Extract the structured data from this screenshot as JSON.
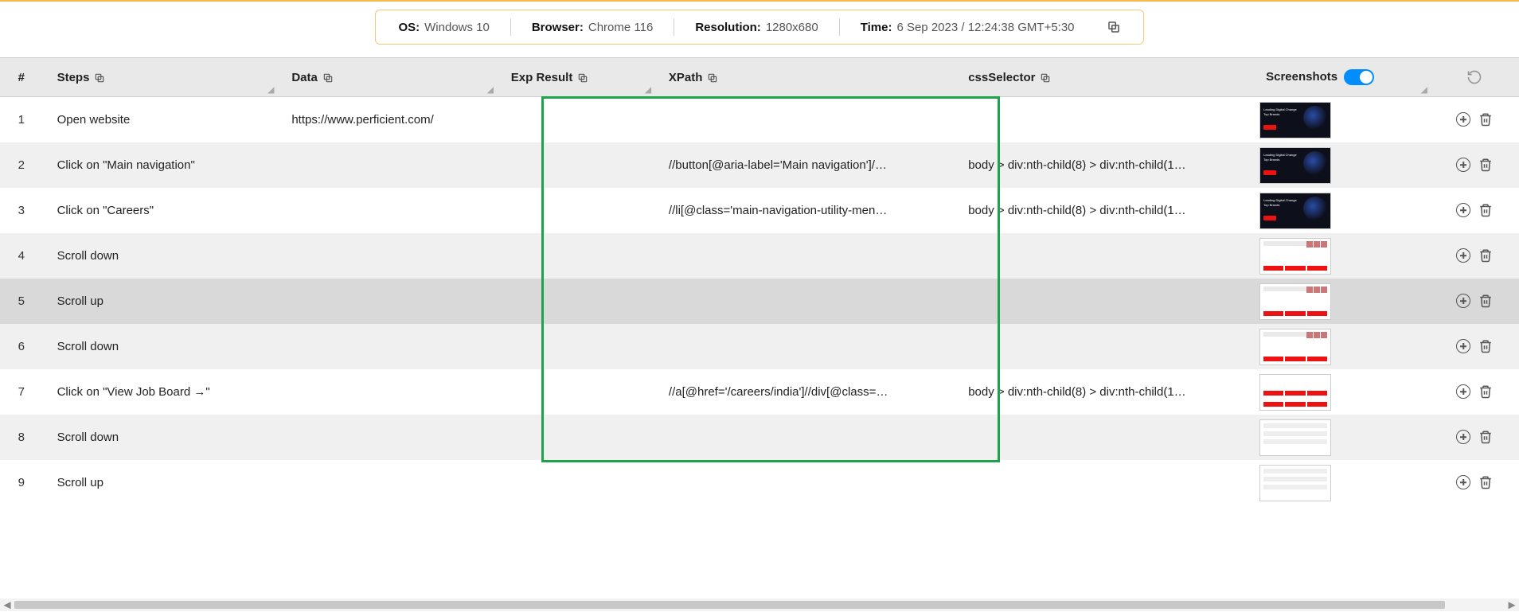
{
  "info": {
    "os_label": "OS:",
    "os_value": "Windows 10",
    "browser_label": "Browser:",
    "browser_value": "Chrome 116",
    "resolution_label": "Resolution:",
    "resolution_value": "1280x680",
    "time_label": "Time:",
    "time_value": "6 Sep 2023 / 12:24:38 GMT+5:30"
  },
  "columns": {
    "num": "#",
    "steps": "Steps",
    "data": "Data",
    "exp": "Exp Result",
    "xpath": "XPath",
    "css": "cssSelector",
    "shots": "Screenshots"
  },
  "toggle_on": true,
  "rows": [
    {
      "n": "1",
      "step": "Open website",
      "data": "https://www.perficient.com/",
      "xpath": "",
      "css": "",
      "thumb": "dark"
    },
    {
      "n": "2",
      "step": "Click on \"Main navigation\"",
      "data": "",
      "xpath": "//button[@aria-label='Main navigation']/…",
      "css": "body > div:nth-child(8) > div:nth-child(1…",
      "thumb": "dark"
    },
    {
      "n": "3",
      "step": "Click on \"Careers\"",
      "data": "",
      "xpath": "//li[@class='main-navigation-utility-men…",
      "css": "body > div:nth-child(8) > div:nth-child(1…",
      "thumb": "dark"
    },
    {
      "n": "4",
      "step": "Scroll down",
      "data": "",
      "xpath": "",
      "css": "",
      "thumb": "light"
    },
    {
      "n": "5",
      "step": "Scroll up",
      "data": "",
      "xpath": "",
      "css": "",
      "thumb": "light",
      "selected": true
    },
    {
      "n": "6",
      "step": "Scroll down",
      "data": "",
      "xpath": "",
      "css": "",
      "thumb": "light"
    },
    {
      "n": "7",
      "step": "Click on \"View Job Board →\"",
      "data": "",
      "xpath": "//a[@href='/careers/india']//div[@class=…",
      "css": "body > div:nth-child(8) > div:nth-child(1…",
      "thumb": "grid"
    },
    {
      "n": "8",
      "step": "Scroll down",
      "data": "",
      "xpath": "",
      "css": "",
      "thumb": "faint"
    },
    {
      "n": "9",
      "step": "Scroll up",
      "data": "",
      "xpath": "",
      "css": "",
      "thumb": "faint"
    }
  ]
}
